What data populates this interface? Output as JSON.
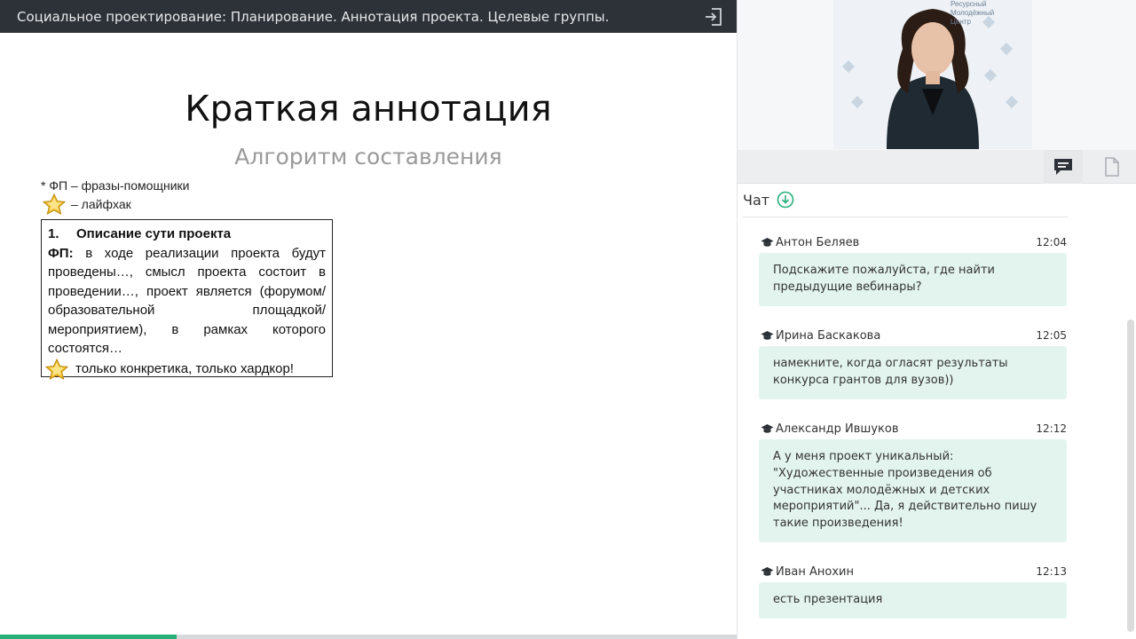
{
  "header": {
    "title": "Социальное проектирование: Планирование. Аннотация проекта. Целевые группы."
  },
  "slide": {
    "title": "Краткая аннотация",
    "subtitle": "Алгоритм составления",
    "note_phrases": "* ФП – фразы-помощники",
    "note_lifehack": "– лайфхак",
    "box": {
      "number": "1.",
      "heading": "Описание сути проекта",
      "fp_label": "ФП:",
      "body": "в ходе реализации проекта будут проведены…, смысл проекта состоит в проведении…, проект является (форумом/образовательной площадкой/мероприятием), в рамках которого состоятся…",
      "hardcore": "только конкретика, только хардкор!"
    }
  },
  "progress": {
    "fraction": 0.24,
    "color": "#27b07a"
  },
  "video": {
    "watermark_lines": [
      "Ресурсный",
      "Молодёжный",
      "Центр"
    ]
  },
  "chat": {
    "title": "Чат",
    "messages": [
      {
        "author": "Антон Беляев",
        "time": "12:04",
        "text": "Подскажите пожалуйста, где найти предыдущие вебинары?"
      },
      {
        "author": "Ирина Баскакова",
        "time": "12:05",
        "text": "намекните, когда огласят результаты конкурса грантов для вузов))"
      },
      {
        "author": "Александр Ившуков",
        "time": "12:12",
        "text": "А у меня проект уникальный: \"Художественные произведения об участниках молодёжных и детских мероприятий\"... Да, я действительно пишу такие произведения!"
      },
      {
        "author": "Иван Анохин",
        "time": "12:13",
        "text": "есть презентация"
      }
    ]
  },
  "colors": {
    "accent": "#27b07a",
    "bubble": "#e3f4ee",
    "topbar": "#2d3238"
  }
}
